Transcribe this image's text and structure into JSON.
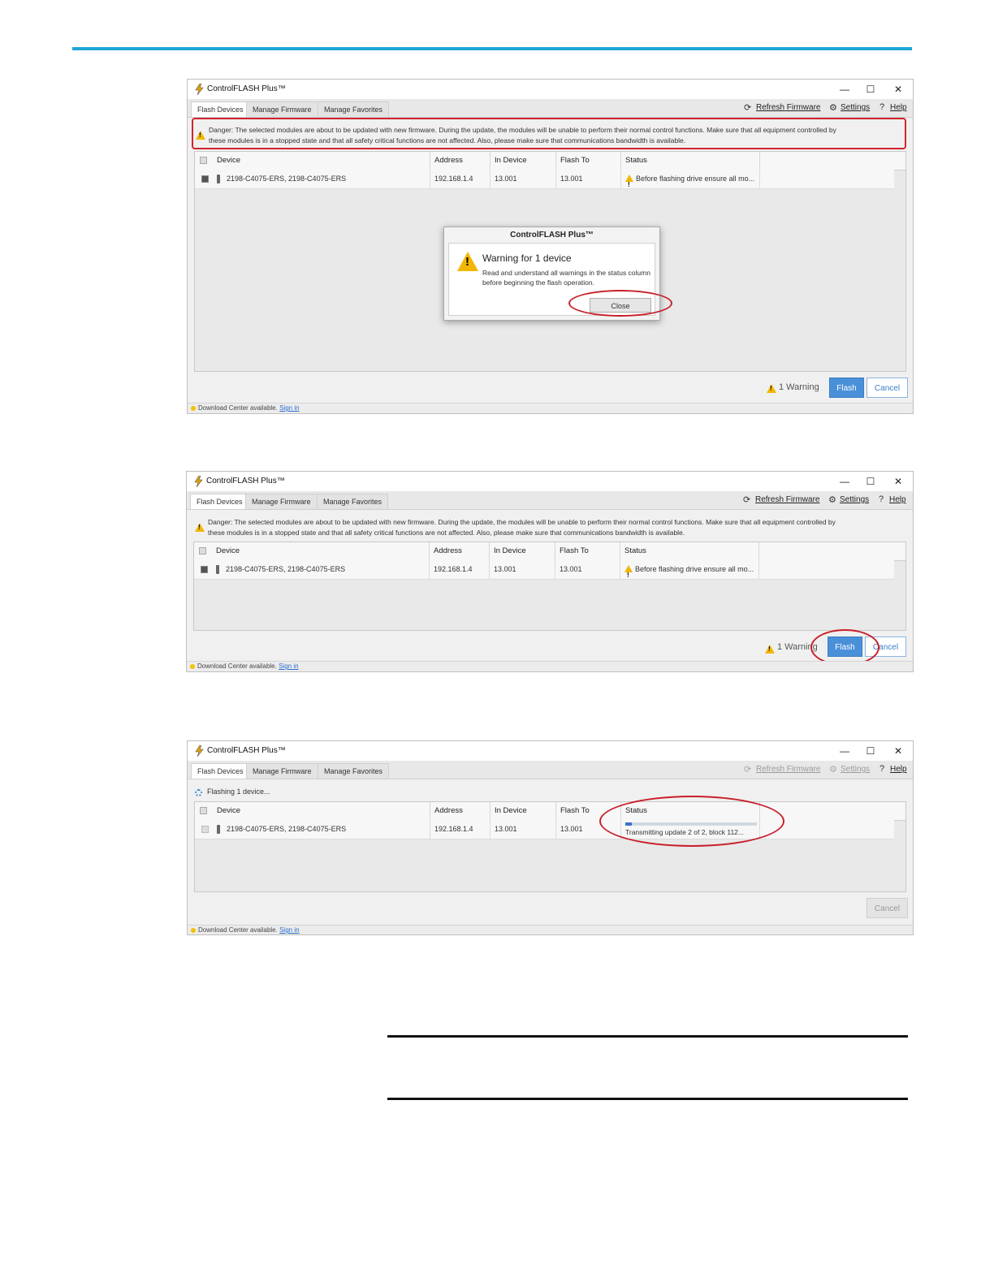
{
  "app_title": "ControlFLASH Plus™",
  "window_controls": {
    "minimize": "—",
    "maximize": "☐",
    "close": "✕"
  },
  "tabs": [
    "Flash Devices",
    "Manage Firmware",
    "Manage Favorites"
  ],
  "toolbar": {
    "refresh": "Refresh Firmware",
    "settings": "Settings",
    "help": "Help"
  },
  "danger_line1": "Danger: The selected modules are about to be updated with new firmware. During the update, the modules will be unable to perform their normal control functions. Make sure that all equipment controlled by",
  "danger_line2": "these modules is in a stopped state and that all safety critical functions are not affected. Also, please make sure that communications bandwidth is available.",
  "columns": [
    "Device",
    "Address",
    "In Device",
    "Flash To",
    "Status"
  ],
  "row": {
    "device": "2198-C4075-ERS, 2198-C4075-ERS",
    "address": "192.168.1.4",
    "in_device": "13.001",
    "flash_to": "13.001",
    "status_warning": "Before flashing drive ensure all mo...",
    "status_progress": "Transmitting update 2 of 2, block 112..."
  },
  "dialog": {
    "title": "ControlFLASH Plus™",
    "heading": "Warning for 1 device",
    "message": "Read and understand all warnings in the status column before beginning the flash operation.",
    "close": "Close"
  },
  "warning_count": "1 Warning",
  "buttons": {
    "flash": "Flash",
    "cancel": "Cancel"
  },
  "footer": {
    "text": "Download Center available.",
    "link": "Sign in"
  },
  "flashing_status": "Flashing 1 device...",
  "progress_fraction": 0.05,
  "colors": {
    "accent_rule": "#1ea7d8",
    "annotation": "#d0252b",
    "primary_button": "#4a90d9",
    "warning": "#f2b705"
  }
}
